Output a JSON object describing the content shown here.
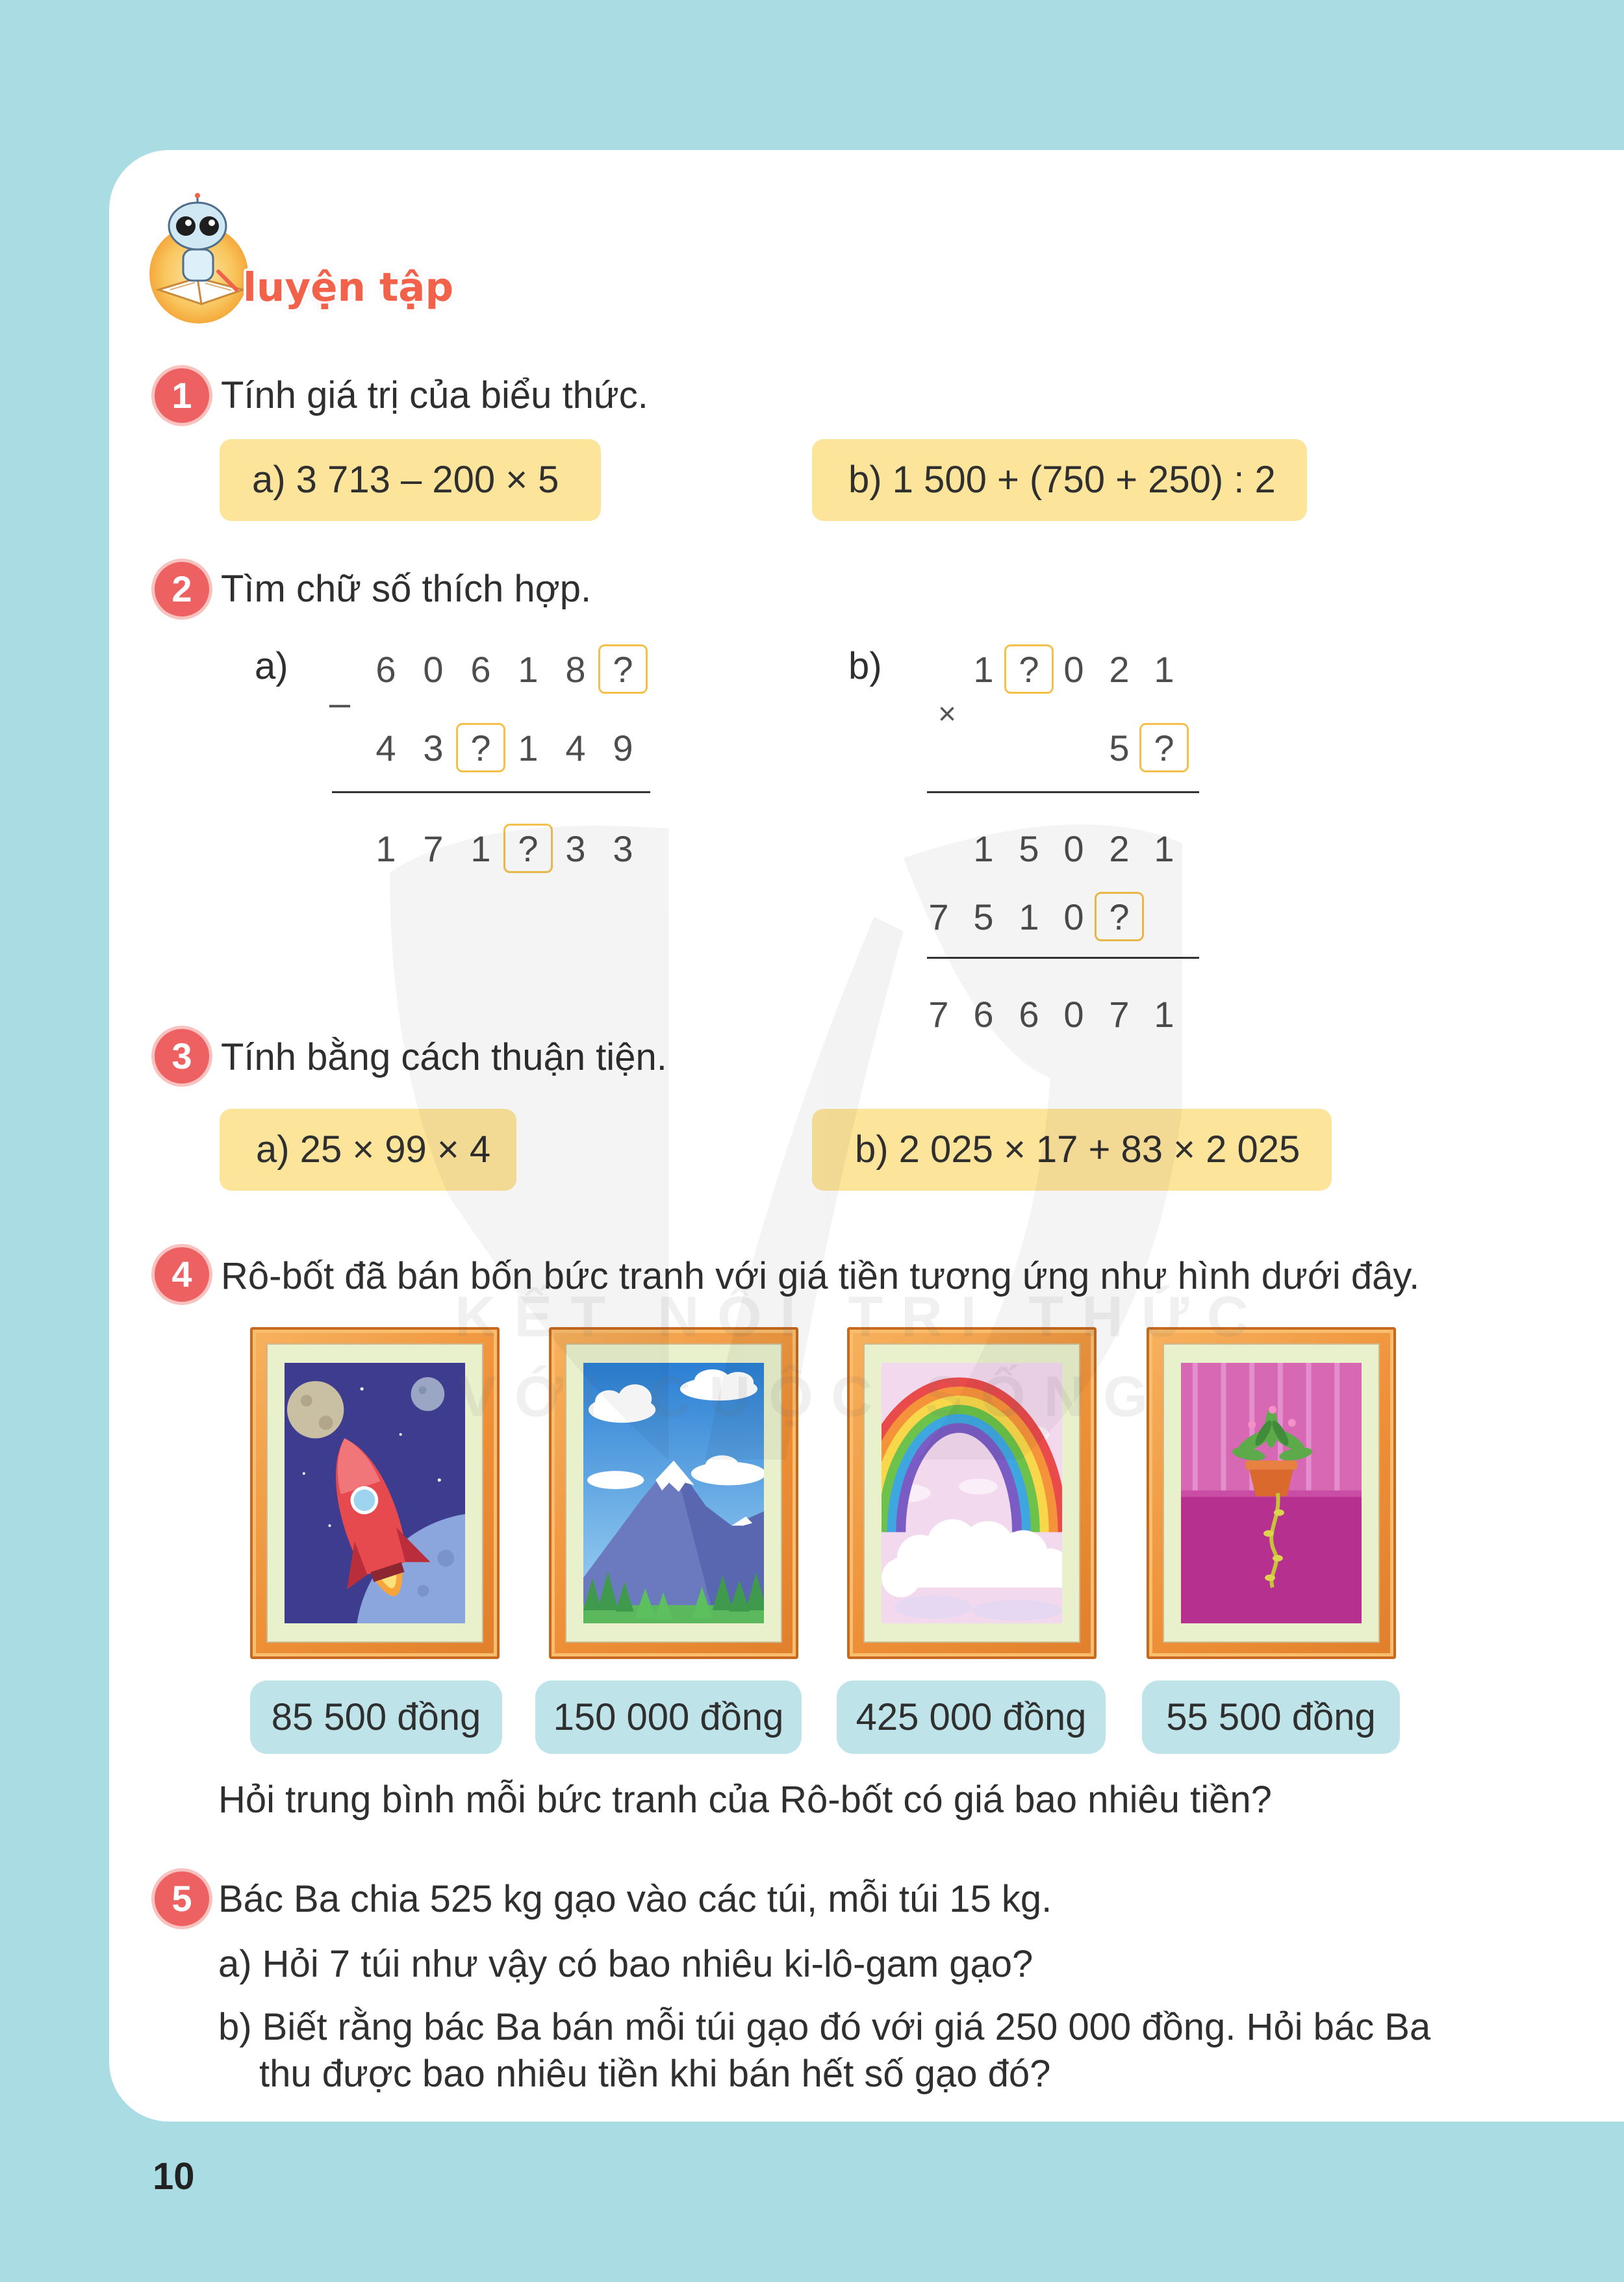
{
  "colors": {
    "page_background": "#AADCE3",
    "card": "#FFFFFF",
    "number_badge": "#EE6163",
    "expression_box": "#FDE49B",
    "price_box": "#BEE4E9",
    "missing_digit_border": "#F2C04B",
    "section_title": "#F2614A"
  },
  "header": {
    "icon": "robot-reading-icon",
    "title": "luyện tập"
  },
  "exercises": [
    {
      "number": "1",
      "prompt": "Tính giá trị của biểu thức.",
      "expressions": [
        "a) 3 713 – 200 × 5",
        "b) 1 500 + (750 + 250) : 2"
      ]
    },
    {
      "number": "2",
      "prompt": "Tìm chữ số thích hợp.",
      "parts": [
        {
          "label": "a)",
          "operator": "–",
          "rows": [
            [
              "6",
              "0",
              "6",
              "1",
              "8",
              "?"
            ],
            [
              "4",
              "3",
              "?",
              "1",
              "4",
              "9"
            ],
            [
              "1",
              "7",
              "1",
              "?",
              "3",
              "3"
            ]
          ]
        },
        {
          "label": "b)",
          "operator": "×",
          "rows": [
            [
              "",
              "1",
              "?",
              "0",
              "2",
              "1"
            ],
            [
              "",
              "",
              "",
              "",
              "5",
              "?"
            ],
            [
              "",
              "1",
              "5",
              "0",
              "2",
              "1"
            ],
            [
              "7",
              "5",
              "1",
              "0",
              "?",
              ""
            ],
            [
              "7",
              "6",
              "6",
              "0",
              "7",
              "1"
            ]
          ]
        }
      ]
    },
    {
      "number": "3",
      "prompt": "Tính bằng cách thuận tiện.",
      "expressions": [
        "a) 25 × 99 × 4",
        "b) 2 025 × 17 + 83 × 2 025"
      ]
    },
    {
      "number": "4",
      "prompt": "Rô-bốt đã bán bốn bức tranh với giá tiền tương ứng như hình dưới đây.",
      "paintings": [
        {
          "icon": "rocket-painting",
          "price": "85 500 đồng"
        },
        {
          "icon": "mountain-painting",
          "price": "150 000 đồng"
        },
        {
          "icon": "rainbow-painting",
          "price": "425 000 đồng"
        },
        {
          "icon": "potted-plant-painting",
          "price": "55 500 đồng"
        }
      ],
      "question": "Hỏi trung bình mỗi bức tranh của Rô-bốt có giá bao nhiêu tiền?"
    },
    {
      "number": "5",
      "prompt": "Bác Ba chia 525 kg gạo vào các túi, mỗi túi 15 kg.",
      "part_a": "a) Hỏi 7 túi như vậy có bao nhiêu ki-lô-gam gạo?",
      "part_b_lines": [
        "b) Biết rằng bác Ba bán mỗi túi gạo đó với giá 250 000 đồng. Hỏi bác Ba",
        "thu được bao nhiêu tiền khi bán hết số gạo đó?"
      ]
    }
  ],
  "watermark": [
    "KẾT NỐI TRI THỨC",
    "VỚI CUỘC SỐNG"
  ],
  "page_number": "10"
}
